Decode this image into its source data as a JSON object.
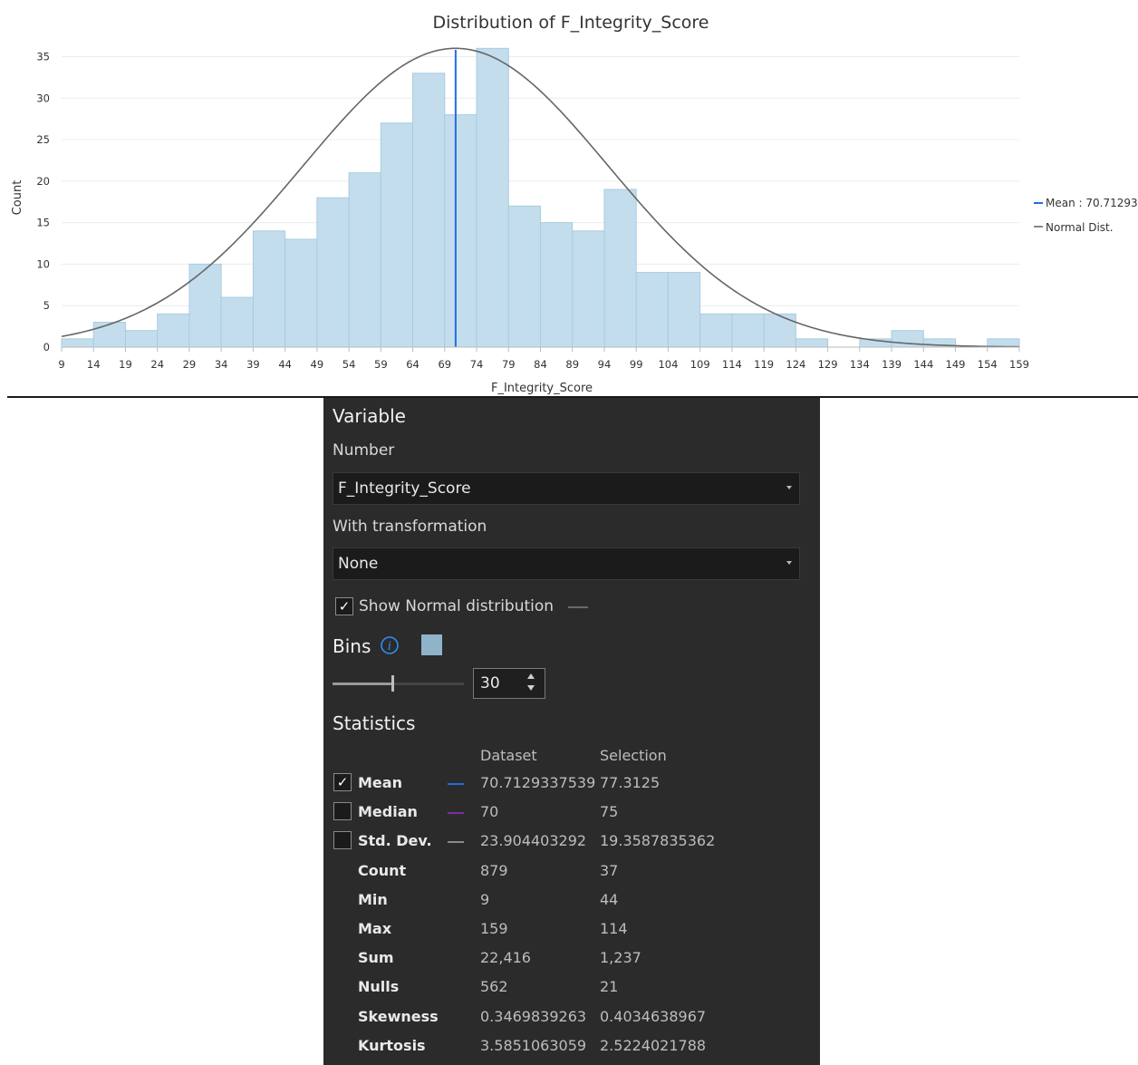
{
  "chart_data": {
    "type": "bar",
    "title": "Distribution of F_Integrity_Score",
    "xlabel": "F_Integrity_Score",
    "ylabel": "Count",
    "xlim": [
      9,
      159
    ],
    "ylim": [
      0,
      38
    ],
    "x_ticks": [
      9,
      14,
      19,
      24,
      29,
      34,
      39,
      44,
      49,
      54,
      59,
      64,
      69,
      74,
      79,
      84,
      89,
      94,
      99,
      104,
      109,
      114,
      119,
      124,
      129,
      134,
      139,
      144,
      149,
      154,
      159
    ],
    "y_ticks": [
      0,
      5,
      10,
      15,
      20,
      25,
      30,
      35
    ],
    "bin_edges": [
      9,
      14,
      19,
      24,
      29,
      34,
      39,
      44,
      49,
      54,
      59,
      64,
      69,
      74,
      79,
      84,
      89,
      94,
      99,
      104,
      109,
      114,
      119,
      124,
      129,
      134,
      139,
      144,
      149,
      154,
      159
    ],
    "values": [
      1,
      3,
      2,
      4,
      10,
      6,
      14,
      13,
      18,
      21,
      27,
      33,
      28,
      36,
      17,
      15,
      14,
      19,
      9,
      9,
      4,
      4,
      4,
      1,
      0,
      1,
      2,
      1,
      0,
      1
    ],
    "mean": 70.71293,
    "std_dev": 23.904403292,
    "normal_peak": 36,
    "grid": true,
    "legend_position": "right",
    "legend": [
      {
        "label": "Mean : 70.71293",
        "color": "#1f6fe0"
      },
      {
        "label": "Normal Dist.",
        "color": "#888888"
      }
    ],
    "bar_color": "#c3dded",
    "bar_edge": "#a9cce0",
    "mean_color": "#1f6fe0",
    "normal_color": "#666666"
  },
  "panel": {
    "variable_title": "Variable",
    "number_label": "Number",
    "number_value": "F_Integrity_Score",
    "transform_label": "With transformation",
    "transform_value": "None",
    "show_normal_label": "Show Normal distribution",
    "show_normal_checked": true,
    "bins_title": "Bins",
    "bins_color": "#8fb3c9",
    "bins_value": "30",
    "bins_slider_fraction": 0.46,
    "statistics_title": "Statistics",
    "col_dataset": "Dataset",
    "col_selection": "Selection",
    "stats": [
      {
        "name": "Mean",
        "checkbox": true,
        "checked": true,
        "line_color": "#1f6fe0",
        "dataset": "70.7129337539",
        "selection": "77.3125"
      },
      {
        "name": "Median",
        "checkbox": true,
        "checked": false,
        "line_color": "#7b2fa0",
        "dataset": "70",
        "selection": "75"
      },
      {
        "name": "Std. Dev.",
        "checkbox": true,
        "checked": false,
        "line_color": "#8a8a8a",
        "dataset": "23.904403292",
        "selection": "19.3587835362"
      },
      {
        "name": "Count",
        "checkbox": false,
        "dataset": "879",
        "selection": "37"
      },
      {
        "name": "Min",
        "checkbox": false,
        "dataset": "9",
        "selection": "44"
      },
      {
        "name": "Max",
        "checkbox": false,
        "dataset": "159",
        "selection": "114"
      },
      {
        "name": "Sum",
        "checkbox": false,
        "dataset": "22,416",
        "selection": "1,237"
      },
      {
        "name": "Nulls",
        "checkbox": false,
        "dataset": "562",
        "selection": "21"
      },
      {
        "name": "Skewness",
        "checkbox": false,
        "dataset": "0.3469839263",
        "selection": "0.4034638967"
      },
      {
        "name": "Kurtosis",
        "checkbox": false,
        "dataset": "3.5851063059",
        "selection": "2.5224021788"
      }
    ]
  }
}
